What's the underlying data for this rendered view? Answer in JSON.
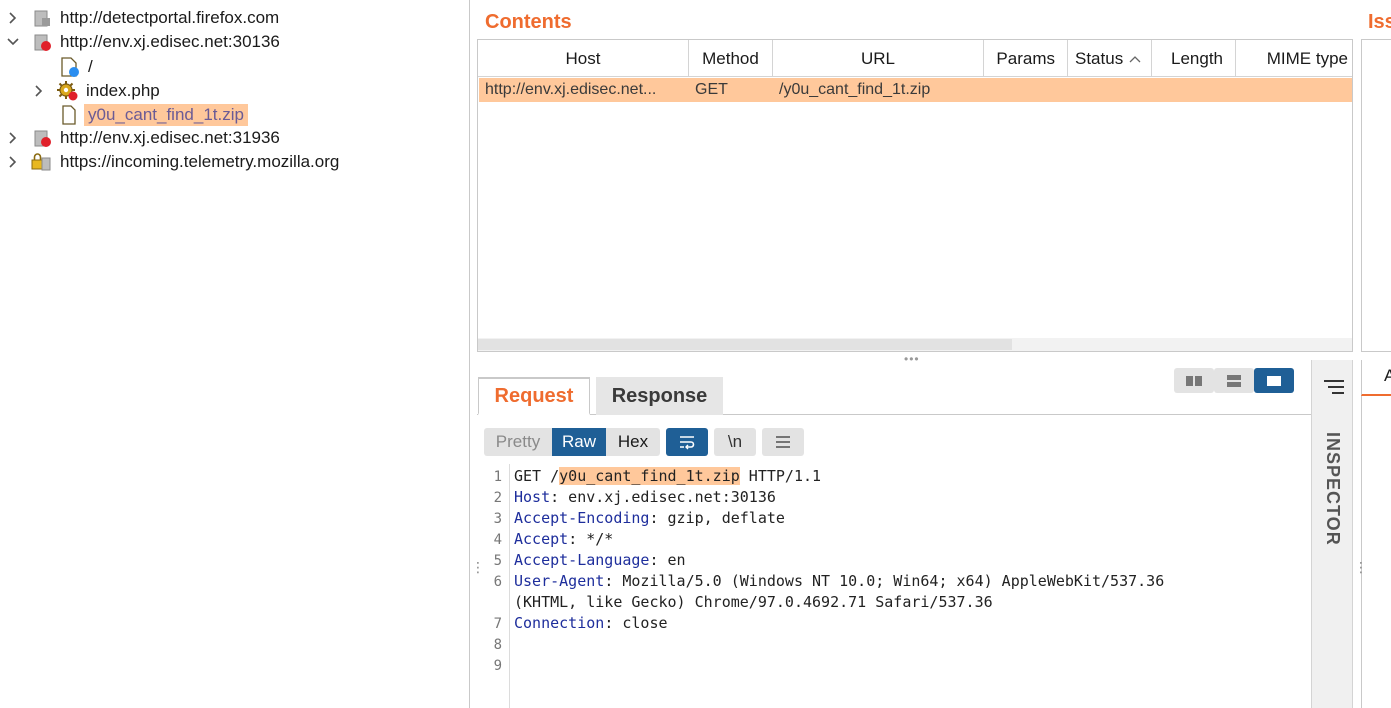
{
  "tree": {
    "items": [
      {
        "label": "http://detectportal.firefox.com"
      },
      {
        "label": "http://env.xj.edisec.net:30136"
      },
      {
        "label": "/"
      },
      {
        "label": "index.php"
      },
      {
        "label": "y0u_cant_find_1t.zip"
      },
      {
        "label": "http://env.xj.edisec.net:31936"
      },
      {
        "label": "https://incoming.telemetry.mozilla.org"
      }
    ]
  },
  "contents": {
    "title": "Contents",
    "columns": [
      "Host",
      "Method",
      "URL",
      "Params",
      "Status",
      "Length",
      "MIME type"
    ],
    "rows": [
      {
        "host": "http://env.xj.edisec.net...",
        "method": "GET",
        "url": "/y0u_cant_find_1t.zip"
      }
    ]
  },
  "issues": {
    "title": "Iss",
    "tab": "A"
  },
  "message": {
    "tabs": {
      "request": "Request",
      "response": "Response"
    },
    "modes": {
      "pretty": "Pretty",
      "raw": "Raw",
      "hex": "Hex"
    },
    "newline_tool": "\\n",
    "lines": [
      {
        "n": "1",
        "k": "",
        "v": "GET /",
        "hl": "y0u_cant_find_1t.zip",
        "rest": " HTTP/1.1"
      },
      {
        "n": "2",
        "k": "Host",
        "v": ": env.xj.edisec.net:30136"
      },
      {
        "n": "3",
        "k": "Accept-Encoding",
        "v": ": gzip, deflate"
      },
      {
        "n": "4",
        "k": "Accept",
        "v": ": */*"
      },
      {
        "n": "5",
        "k": "Accept-Language",
        "v": ": en"
      },
      {
        "n": "6",
        "k": "User-Agent",
        "v": ": Mozilla/5.0 (Windows NT 10.0; Win64; x64) AppleWebKit/537.36"
      },
      {
        "n": "",
        "k": "",
        "v": "(KHTML, like Gecko) Chrome/97.0.4692.71 Safari/537.36"
      },
      {
        "n": "7",
        "k": "Connection",
        "v": ": close"
      },
      {
        "n": "8",
        "k": "",
        "v": ""
      },
      {
        "n": "9",
        "k": "",
        "v": ""
      }
    ]
  },
  "inspector": {
    "label": "INSPECTOR"
  },
  "colors": {
    "accent": "#ef6c2f",
    "selection": "#ffc89b",
    "active_button": "#1f5f96",
    "header_key": "#1e2e9c"
  },
  "icons": {
    "host": "host-icon",
    "file": "file-icon",
    "folder": "folder-icon",
    "script": "gear-script-icon",
    "lock": "lock-icon"
  }
}
